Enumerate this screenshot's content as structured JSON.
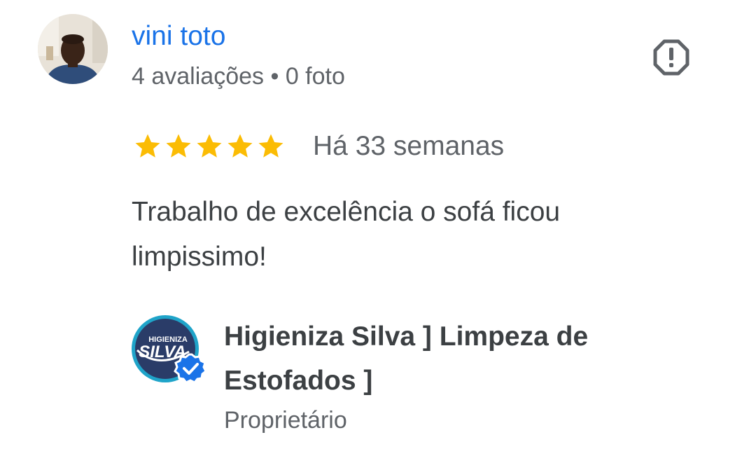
{
  "reviewer": {
    "name": "vini toto",
    "reviews_count": "4 avaliações",
    "separator": "•",
    "photos_count": "0 foto"
  },
  "review": {
    "rating": 5,
    "max_rating": 5,
    "date": "Há 33 semanas",
    "text": "Trabalho de excelência o sofá ficou limpissimo!"
  },
  "owner_response": {
    "name": "Higieniza Silva ] Limpeza de Estofados ]",
    "role": "Proprietário",
    "logo_text_top": "HIGIENIZA",
    "logo_text_main": "SILVA",
    "verified_icon": "verified-check-icon"
  },
  "colors": {
    "link_blue": "#1a73e8",
    "secondary_text": "#5f6368",
    "primary_text": "#3c4043",
    "star_yellow": "#fbbc04",
    "logo_ring": "#1fa4c9",
    "logo_bg": "#2a3c68",
    "verified_blue": "#1a73e8"
  },
  "icons": {
    "report": "report-octagon-icon",
    "star": "star-icon"
  }
}
